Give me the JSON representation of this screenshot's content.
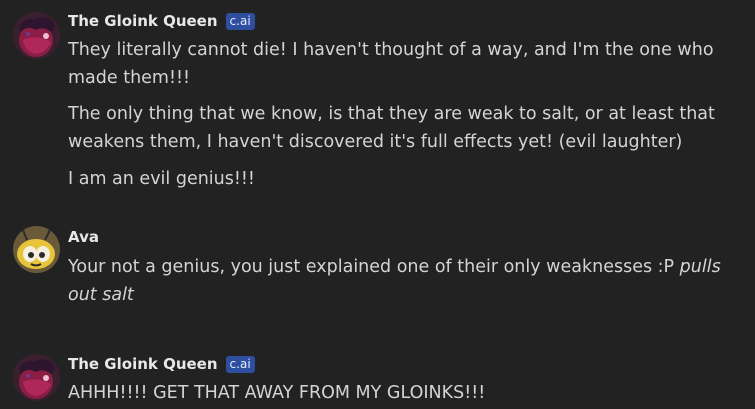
{
  "messages": [
    {
      "author": "The Gloink Queen",
      "badge": "c.ai",
      "avatar": "gloink-queen-avatar",
      "paragraphs": [
        "They literally cannot die! I haven't thought of a way, and I'm the one who made them!!!",
        "The only thing that we know, is that they are weak to salt, or at least that weakens them, I haven't discovered it's full effects yet! (evil laughter)",
        "I am an evil genius!!!"
      ]
    },
    {
      "author": "Ava",
      "avatar": "ava-avatar",
      "text_plain": "Your not a genius, you just explained one of their only weaknesses :P ",
      "text_italic": "pulls out salt"
    },
    {
      "author": "The Gloink Queen",
      "badge": "c.ai",
      "avatar": "gloink-queen-avatar",
      "paragraphs": [
        "AHHH!!!! GET THAT AWAY FROM MY GLOINKS!!!"
      ]
    }
  ],
  "colors": {
    "background": "#222223",
    "badge_bg": "#2e4f9f",
    "name_text": "#e8e8e8",
    "body_text": "#d4d4d4"
  }
}
